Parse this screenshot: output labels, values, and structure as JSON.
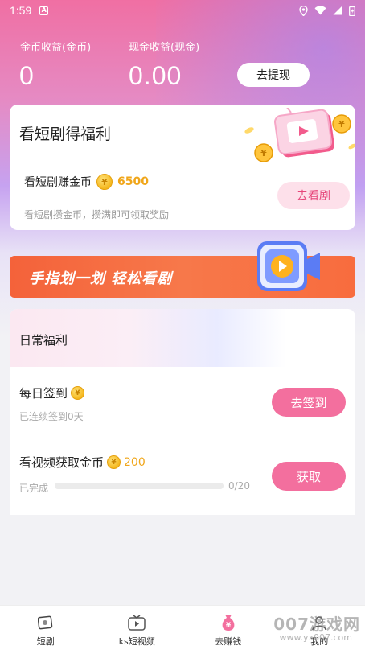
{
  "status_bar": {
    "time": "1:59",
    "notification_glyph": "A",
    "icons": [
      "location-icon",
      "wifi-icon",
      "signal-icon",
      "battery-icon"
    ]
  },
  "earnings": {
    "coin_label": "金币收益(金币)",
    "coin_value": "0",
    "cash_label": "现金收益(现金)",
    "cash_value": "0.00",
    "withdraw_button": "去提现"
  },
  "drama_card": {
    "title": "看短剧得福利",
    "earn_label": "看短剧赚金币",
    "earn_coins": "6500",
    "description": "看短剧攒金币，攒满即可领取奖励",
    "watch_button": "去看剧"
  },
  "banner": {
    "text": "手指划一划 轻松看剧"
  },
  "daily": {
    "title": "日常福利",
    "tasks": [
      {
        "title": "每日签到",
        "desc": "已连续签到0天",
        "button": "去签到"
      },
      {
        "title": "看视频获取金币",
        "reward": "200",
        "progress_label": "已完成",
        "progress_text": "0/20",
        "progress_done": 0,
        "progress_total": 20,
        "button": "获取"
      }
    ]
  },
  "tabbar": {
    "items": [
      {
        "label": "短剧",
        "icon": "drama-icon"
      },
      {
        "label": "ks短视频",
        "icon": "tv-icon"
      },
      {
        "label": "去赚钱",
        "icon": "money-bag-icon"
      },
      {
        "label": "我的",
        "icon": "profile-icon"
      }
    ]
  },
  "watermark": {
    "text": "007游戏网",
    "sub": "www.yx007.com"
  },
  "colors": {
    "accent_pink": "#f36f9e",
    "coin_gold": "#f0a61a",
    "banner_orange": "#f4623a"
  }
}
